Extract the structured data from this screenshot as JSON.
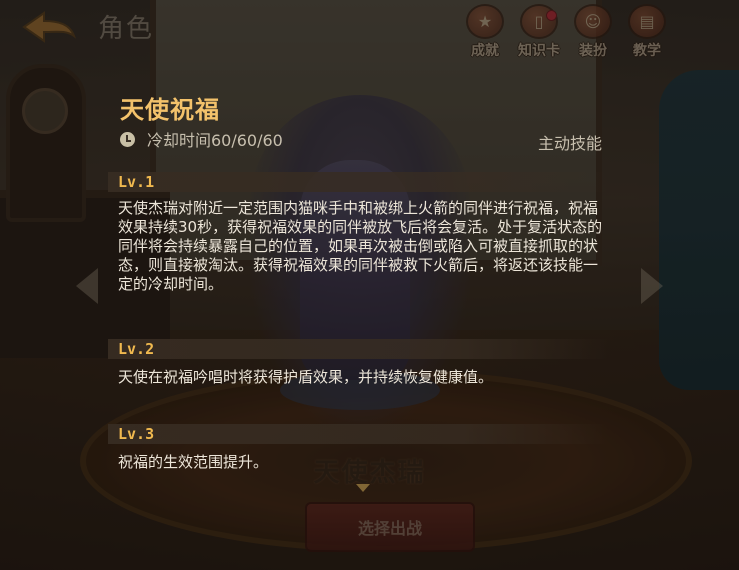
{
  "header": {
    "title": "角色",
    "menu": [
      {
        "label": "成就",
        "icon": "trophy-icon",
        "badge": false
      },
      {
        "label": "知识卡",
        "icon": "card-icon",
        "badge": true
      },
      {
        "label": "装扮",
        "icon": "outfit-icon",
        "badge": false
      },
      {
        "label": "教学",
        "icon": "book-icon",
        "badge": false
      }
    ]
  },
  "skill": {
    "name": "天使祝福",
    "cooldown": "冷却时间60/60/60",
    "type": "主动技能",
    "levels": [
      {
        "level": "Lv.1",
        "desc": "天使杰瑞对附近一定范围内猫咪手中和被绑上火箭的同伴进行祝福，祝福效果持续30秒，获得祝福效果的同伴被放飞后将会复活。处于复活状态的同伴将会持续暴露自己的位置，如果再次被击倒或陷入可被直接抓取的状态，则直接被淘汰。获得祝福效果的同伴被救下火箭后，将返还该技能一定的冷却时间。"
      },
      {
        "level": "Lv.2",
        "desc": "天使在祝福吟唱时将获得护盾效果，并持续恢复健康值。"
      },
      {
        "level": "Lv.3",
        "desc": "祝福的生效范围提升。"
      }
    ]
  },
  "character": {
    "name": "天使杰瑞"
  },
  "select_button": "选择出战",
  "colors": {
    "skill_title": "#f3c26b",
    "level_label": "#f0b94f",
    "desc_text": "#ede6d9",
    "badge": "#e2243a"
  }
}
